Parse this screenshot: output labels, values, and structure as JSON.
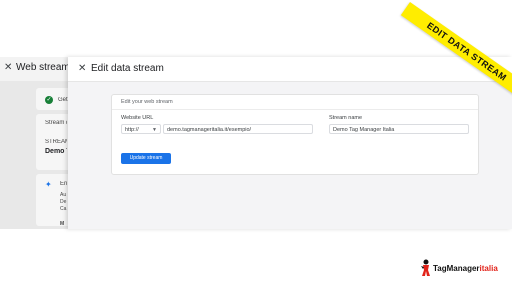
{
  "background_panel": {
    "title": "Web stream de",
    "status_text": "Get",
    "stream_heading": "Stream d",
    "stream_label": "STREAM",
    "stream_value": "Demo T",
    "enhanced_label": "En",
    "enhanced_desc_1": "Au",
    "enhanced_desc_2": "De",
    "enhanced_desc_3": "Ca",
    "footer_letter": "M"
  },
  "dialog": {
    "title": "Edit data stream",
    "card_title": "Edit your web stream",
    "website_url_label": "Website URL",
    "protocol_value": "http://",
    "url_value": "demo.tagmanageritalia.it/esempio/",
    "stream_name_label": "Stream name",
    "stream_name_value": "Demo Tag Manager Italia",
    "update_button": "Update stream"
  },
  "ribbon": {
    "text": "EDIT DATA STREAM",
    "color": "#ffed00"
  },
  "logo": {
    "text_main": "TagManager",
    "text_accent": "italia",
    "accent_color": "#e2231a"
  },
  "colors": {
    "primary": "#1a73e8",
    "success": "#188038"
  },
  "icons": {
    "close": "close-icon",
    "check": "check-circle-icon",
    "sparkle": "sparkle-icon",
    "dropdown": "chevron-down-icon"
  }
}
